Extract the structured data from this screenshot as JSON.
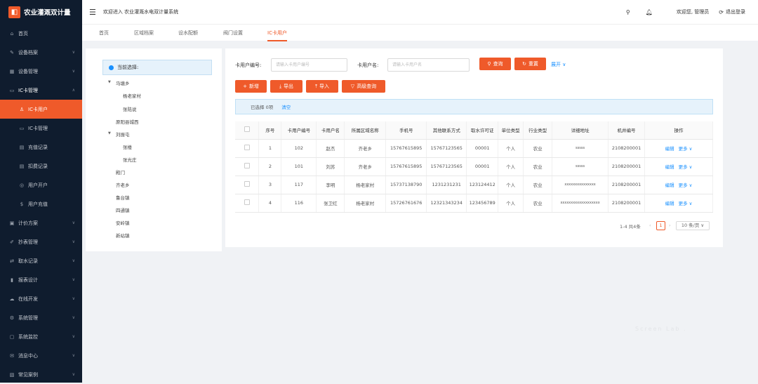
{
  "app": {
    "title": "农业灌溉双计量",
    "welcome": "欢迎进入 农业灌溉水电双计量系统"
  },
  "header": {
    "user_greeting": "欢迎您, 管理员",
    "logout": "退出登录"
  },
  "sidebar": {
    "items": [
      {
        "label": "首页",
        "icon": "home-icon"
      },
      {
        "label": "设备档案",
        "icon": "wrench-icon"
      },
      {
        "label": "设备管理",
        "icon": "grid-icon"
      },
      {
        "label": "IC卡管理",
        "icon": "card-icon"
      },
      {
        "label": "IC卡用户",
        "icon": "user-icon"
      },
      {
        "label": "IC卡管理",
        "icon": "card-icon"
      },
      {
        "label": "充值记录",
        "icon": "doc-icon"
      },
      {
        "label": "扣费记录",
        "icon": "doc-icon"
      },
      {
        "label": "用户开户",
        "icon": "circle-icon"
      },
      {
        "label": "用户充值",
        "icon": "dollar-icon"
      },
      {
        "label": "计价方案",
        "icon": "calc-icon"
      },
      {
        "label": "抄表管理",
        "icon": "edit-icon"
      },
      {
        "label": "取水记录",
        "icon": "exchange-icon"
      },
      {
        "label": "报表设计",
        "icon": "chart-icon"
      },
      {
        "label": "在线开发",
        "icon": "cloud-icon"
      },
      {
        "label": "系统管理",
        "icon": "gear-icon"
      },
      {
        "label": "系统监控",
        "icon": "monitor-icon"
      },
      {
        "label": "消息中心",
        "icon": "message-icon"
      },
      {
        "label": "常见案例",
        "icon": "case-icon"
      }
    ]
  },
  "tabs": [
    "首页",
    "区域档案",
    "设水配额",
    "阀门设置",
    "IC卡用户"
  ],
  "tree": {
    "head": "当前选择:",
    "nodes": [
      "马塘乡",
      "杨老家村",
      "张陆说",
      "原阳县城西",
      "刘振屯",
      "张楼",
      "张光庄",
      "殿门",
      "齐老乡",
      "鲁台镇",
      "四通镇",
      "安岭镇",
      "新站镇"
    ]
  },
  "search": {
    "card_no_label": "卡用户编号:",
    "card_no_placeholder": "请输入卡用户编号",
    "card_name_label": "卡用户名:",
    "card_name_placeholder": "请输入卡用户名",
    "query": "查询",
    "reset": "重置",
    "expand": "展开"
  },
  "actions": {
    "add": "新增",
    "export": "导出",
    "import": "导入",
    "advanced": "高级查询"
  },
  "selection": {
    "text": "已选择 0项",
    "clear": "清空"
  },
  "table": {
    "headers": [
      "",
      "序号",
      "卡用户编号",
      "卡用户名",
      "所属区域名称",
      "手机号",
      "其他联系方式",
      "取水许可证",
      "单位类型",
      "行业类型",
      "详细地址",
      "机井编号",
      "操作"
    ],
    "rows": [
      [
        "1",
        "102",
        "赵杰",
        "齐老乡",
        "15767615895",
        "15767123565",
        "00001",
        "个人",
        "农业",
        "sssss",
        "2108200001"
      ],
      [
        "2",
        "101",
        "刘苏",
        "齐老乡",
        "15767615895",
        "15767123565",
        "00001",
        "个人",
        "农业",
        "sssss",
        "2108200001"
      ],
      [
        "3",
        "117",
        "李明",
        "杨老家村",
        "15737138790",
        "1231231231",
        "123124412",
        "个人",
        "农业",
        "xxxxxxxxxxxxxxx",
        "2108200001"
      ],
      [
        "4",
        "116",
        "张卫红",
        "杨老家村",
        "15726761676",
        "12321343234",
        "123456789",
        "个人",
        "农业",
        "xxxxxxxxxxxxxxxxxxx",
        "2108200001"
      ]
    ],
    "edit": "编辑",
    "more": "更多"
  },
  "pagination": {
    "summary": "1-4 共4条",
    "current": "1",
    "page_size": "10 条/页"
  },
  "watermark": "Screen Lab .",
  "colors": {
    "accent": "#ef5a2a",
    "sidebar": "#0f1c2e",
    "link": "#1890ff"
  }
}
